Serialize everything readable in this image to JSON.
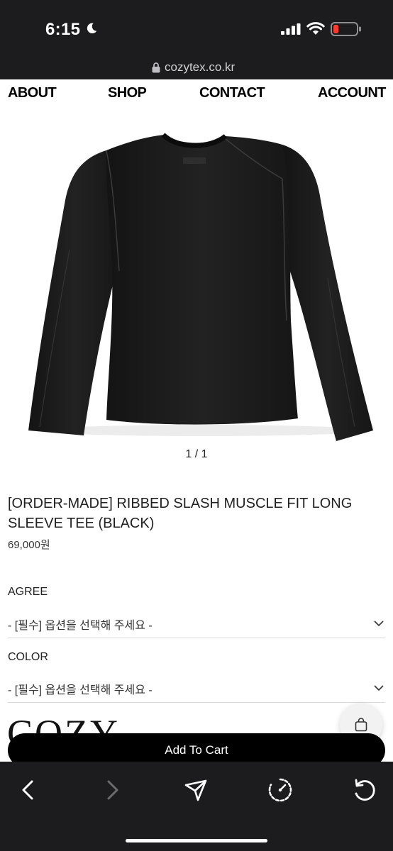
{
  "status_bar": {
    "time": "6:15",
    "icons": [
      "moon-icon",
      "signal-icon",
      "wifi-icon",
      "battery-low-icon"
    ],
    "battery_color": "#ff3b30"
  },
  "browser": {
    "url": "cozytex.co.kr",
    "toolbar_icons": [
      "back-arrow-icon",
      "forward-arrow-icon",
      "share-icon",
      "speedometer-icon",
      "reload-icon"
    ]
  },
  "nav": {
    "about": "ABOUT",
    "shop": "SHOP",
    "contact": "CONTACT",
    "account": "ACCOUNT"
  },
  "product": {
    "image_counter": "1 / 1",
    "title": "[ORDER-MADE] RIBBED SLASH MUSCLE FIT LONG SLEEVE TEE (BLACK)",
    "price": "69,000원",
    "options": [
      {
        "label": "AGREE",
        "selected": "- [필수] 옵션을 선택해 주세요 -"
      },
      {
        "label": "COLOR",
        "selected": "- [필수] 옵션을 선택해 주세요 -"
      }
    ]
  },
  "brand": {
    "logo_text": "COZY-TEX",
    "reg_mark": "®"
  },
  "cart": {
    "button_label": "Add To Cart",
    "float_icon": "shopping-bag-icon"
  }
}
